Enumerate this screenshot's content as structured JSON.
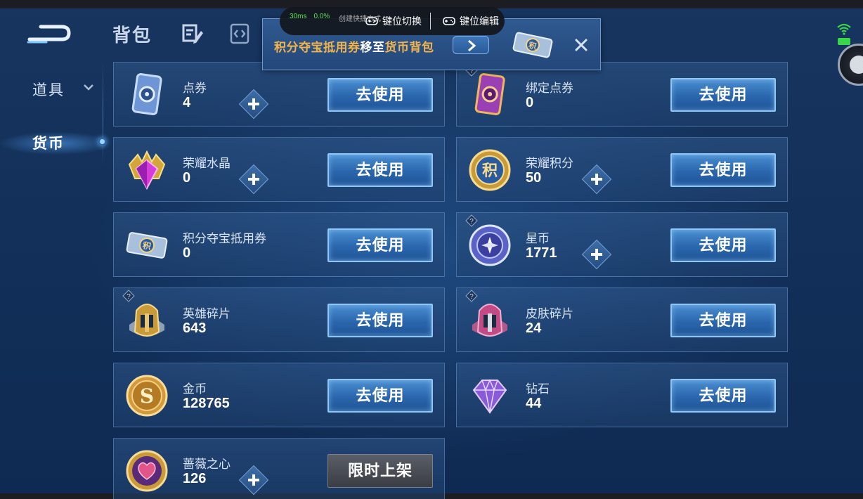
{
  "header": {
    "tab_bag": "背包"
  },
  "overlay": {
    "latency": "30ms",
    "loss": "0.0%",
    "sub": "创建快捷方式",
    "switch_label": "键位切换",
    "edit_label": "键位编辑"
  },
  "banner": {
    "part1": "积分夺宝抵用券",
    "part2": "移至",
    "part3": "货币背包"
  },
  "sidebar": {
    "items": [
      {
        "label": "道具"
      },
      {
        "label": "货币"
      }
    ]
  },
  "cards": [
    {
      "name": "点券",
      "count": "4",
      "button": "去使用"
    },
    {
      "name": "绑定点券",
      "count": "0",
      "button": "去使用"
    },
    {
      "name": "荣耀水晶",
      "count": "0",
      "button": "去使用"
    },
    {
      "name": "荣耀积分",
      "count": "50",
      "button": "去使用"
    },
    {
      "name": "积分夺宝抵用券",
      "count": "0",
      "button": "去使用"
    },
    {
      "name": "星币",
      "count": "1771",
      "button": "去使用"
    },
    {
      "name": "英雄碎片",
      "count": "643",
      "button": "去使用"
    },
    {
      "name": "皮肤碎片",
      "count": "24",
      "button": "去使用"
    },
    {
      "name": "金币",
      "count": "128765",
      "button": "去使用"
    },
    {
      "name": "钻石",
      "count": "44",
      "button": "去使用"
    },
    {
      "name": "蔷薇之心",
      "count": "126",
      "button": "限时上架"
    }
  ],
  "icons": {
    "ticket_symbol": "积",
    "coin_symbol": "S"
  }
}
